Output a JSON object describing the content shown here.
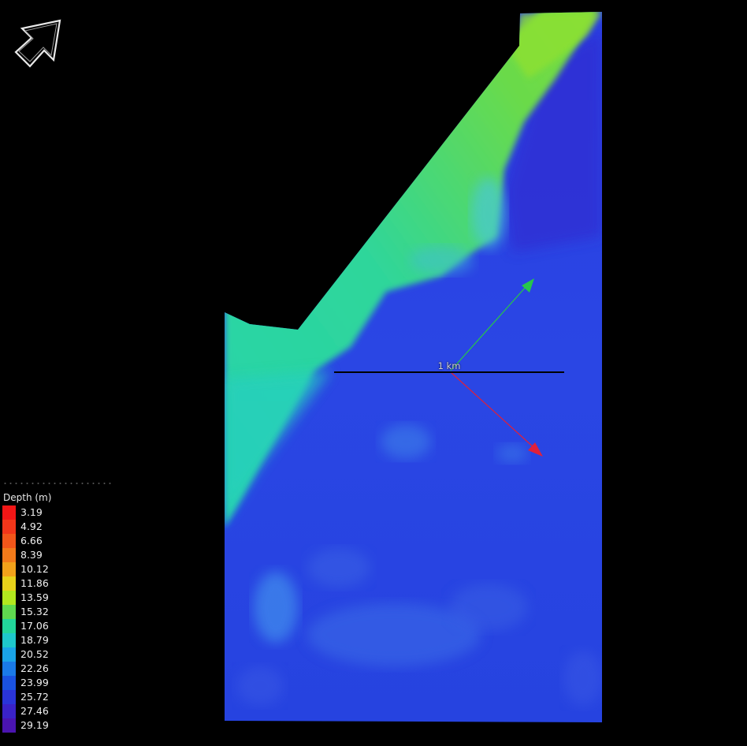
{
  "map": {
    "scale_bar_label": "1 km",
    "colors": {
      "background": "#000000",
      "shallow_zone": "#5fd94f",
      "mid_zone": "#2fd1a8",
      "deep_zone": "#2a3de0",
      "axis_green": "#27c64a",
      "axis_red": "#e0203a",
      "scale_bar": "#000000"
    }
  },
  "north_arrow": {
    "icon": "north-arrow-icon"
  },
  "legend": {
    "title": "Depth (m)",
    "items": [
      {
        "label": "3.19",
        "color": "#f21616"
      },
      {
        "label": "4.92",
        "color": "#f2361a"
      },
      {
        "label": "6.66",
        "color": "#f2561a"
      },
      {
        "label": "8.39",
        "color": "#f27a1a"
      },
      {
        "label": "10.12",
        "color": "#f2a21a"
      },
      {
        "label": "11.86",
        "color": "#e8d21a"
      },
      {
        "label": "13.59",
        "color": "#b2e81e"
      },
      {
        "label": "15.32",
        "color": "#5fd94f"
      },
      {
        "label": "17.06",
        "color": "#22d59a"
      },
      {
        "label": "18.79",
        "color": "#1ec8cc"
      },
      {
        "label": "20.52",
        "color": "#1aa4e8"
      },
      {
        "label": "22.26",
        "color": "#1a7ae8"
      },
      {
        "label": "23.99",
        "color": "#1a52e0"
      },
      {
        "label": "25.72",
        "color": "#2a34d8"
      },
      {
        "label": "27.46",
        "color": "#3a22c8"
      },
      {
        "label": "29.19",
        "color": "#4a14b0"
      }
    ]
  }
}
